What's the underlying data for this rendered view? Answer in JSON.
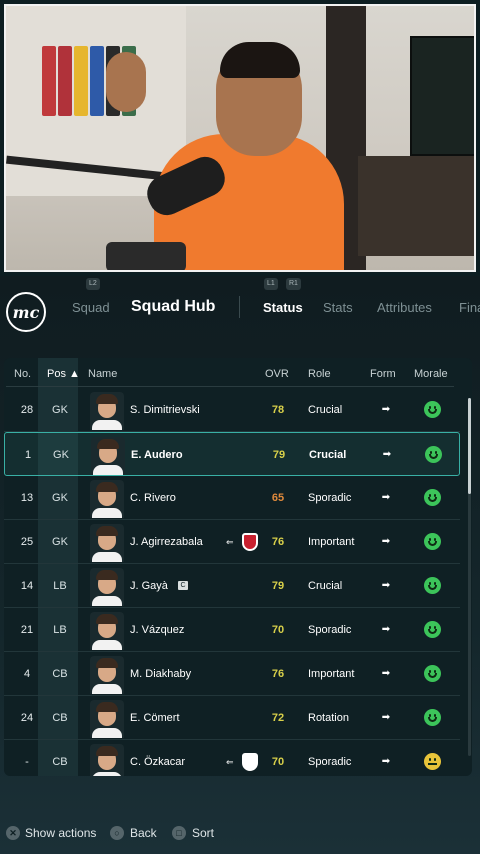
{
  "controller_hints": {
    "left_top": "L2",
    "l1": "L1",
    "r1": "R1"
  },
  "logo_text": "mc",
  "nav": {
    "squad": "Squad",
    "title": "Squad Hub",
    "tabs": [
      "Status",
      "Stats",
      "Attributes",
      "Fina"
    ],
    "active_tab": "Status"
  },
  "table": {
    "headers": {
      "no": "No.",
      "pos": "Pos ▲",
      "name": "Name",
      "ovr": "OVR",
      "role": "Role",
      "form": "Form",
      "morale": "Morale"
    },
    "rows": [
      {
        "no": "28",
        "pos": "GK",
        "name": "S. Dimitrievski",
        "ovr": "78",
        "ovr_color": "#d8d04a",
        "role": "Crucial",
        "form": "➡",
        "morale": "happy"
      },
      {
        "no": "1",
        "pos": "GK",
        "name": "E. Audero",
        "ovr": "79",
        "ovr_color": "#d8d04a",
        "role": "Crucial",
        "form": "➡",
        "morale": "happy",
        "selected": true
      },
      {
        "no": "13",
        "pos": "GK",
        "name": "C. Rivero",
        "ovr": "65",
        "ovr_color": "#e08a3c",
        "role": "Sporadic",
        "form": "➡",
        "morale": "happy"
      },
      {
        "no": "25",
        "pos": "GK",
        "name": "J. Agirrezabala",
        "ovr": "76",
        "ovr_color": "#d8d04a",
        "role": "Important",
        "form": "➡",
        "morale": "happy",
        "loan_in": "⇐",
        "club_badge": "athletic-club-badge"
      },
      {
        "no": "14",
        "pos": "LB",
        "name": "J. Gayà",
        "ovr": "79",
        "ovr_color": "#d8d04a",
        "role": "Crucial",
        "form": "➡",
        "morale": "happy",
        "captain": "C"
      },
      {
        "no": "21",
        "pos": "LB",
        "name": "J. Vázquez",
        "ovr": "70",
        "ovr_color": "#d8d04a",
        "role": "Sporadic",
        "form": "➡",
        "morale": "happy"
      },
      {
        "no": "4",
        "pos": "CB",
        "name": "M. Diakhaby",
        "ovr": "76",
        "ovr_color": "#d8d04a",
        "role": "Important",
        "form": "➡",
        "morale": "happy"
      },
      {
        "no": "24",
        "pos": "CB",
        "name": "E. Cömert",
        "ovr": "72",
        "ovr_color": "#d8d04a",
        "role": "Rotation",
        "form": "➡",
        "morale": "happy"
      },
      {
        "no": "-",
        "pos": "CB",
        "name": "C. Özkacar",
        "ovr": "70",
        "ovr_color": "#d8d04a",
        "role": "Sporadic",
        "form": "➡",
        "morale": "neutral",
        "loan_in": "⇐",
        "club_badge": "koln-badge"
      }
    ]
  },
  "footer": {
    "show_actions": "Show actions",
    "back": "Back",
    "sort": "Sort"
  },
  "colors": {
    "accent": "#39b0a5",
    "morale_happy": "#3cc45a",
    "morale_neutral": "#e8c43a"
  }
}
